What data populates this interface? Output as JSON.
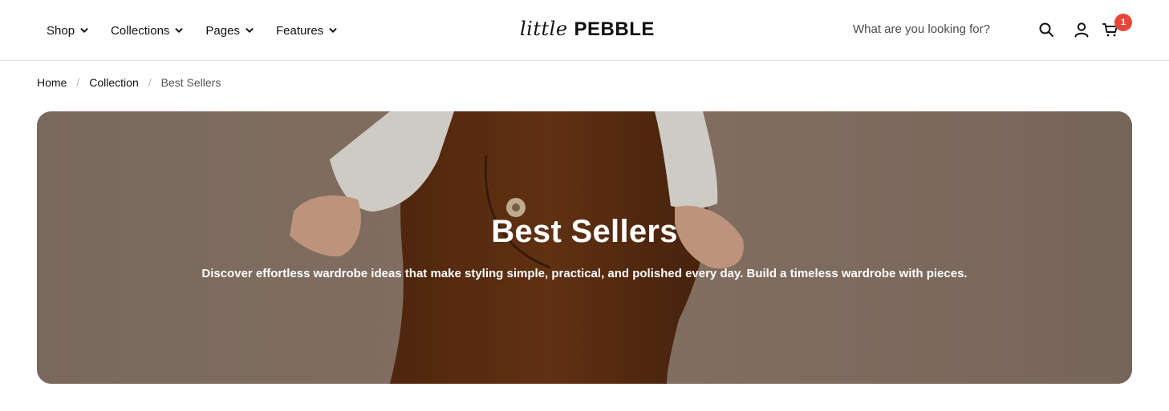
{
  "header": {
    "nav": [
      {
        "label": "Shop"
      },
      {
        "label": "Collections"
      },
      {
        "label": "Pages"
      },
      {
        "label": "Features"
      }
    ],
    "logo_script": "little",
    "logo_bold": "PEBBLE",
    "search_placeholder": "What are you looking for?",
    "cart_count": "1",
    "icons": [
      "chevron-down-icon",
      "search-icon",
      "account-icon",
      "cart-icon"
    ],
    "badge_color": "#e5483a"
  },
  "breadcrumb": {
    "items": [
      "Home",
      "Collection"
    ],
    "current": "Best Sellers",
    "separator": "/"
  },
  "hero": {
    "title": "Best Sellers",
    "subtitle": "Discover effortless wardrobe ideas that make styling simple, practical, and polished every day. Build a timeless wardrobe with pieces."
  }
}
